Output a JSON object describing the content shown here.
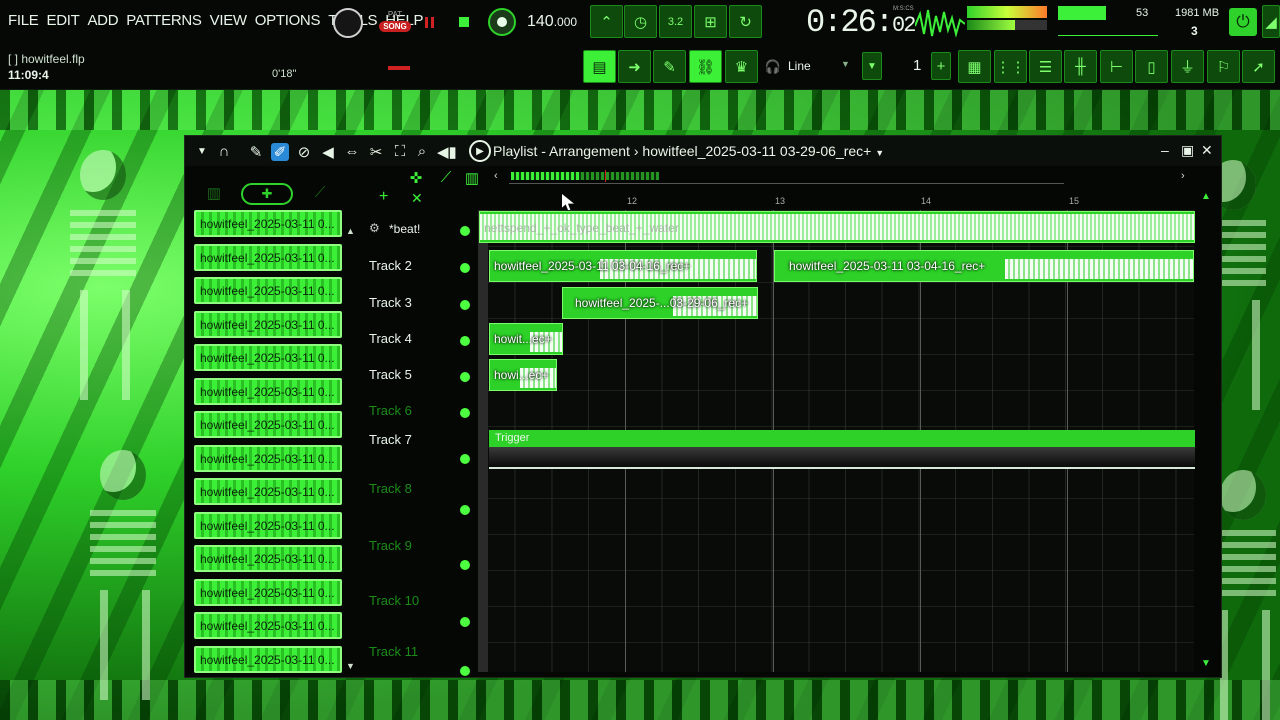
{
  "menu": [
    "FILE",
    "EDIT",
    "ADD",
    "PATTERNS",
    "VIEW",
    "OPTIONS",
    "TOOLS",
    "HELP"
  ],
  "project": {
    "file": "[   ] howitfeel.flp",
    "time": "11:09:4",
    "hint_time": "0'18\""
  },
  "transport": {
    "pat_label": "PAT",
    "song_label": "SONG",
    "tempo": "140",
    "tempo_frac": ".000",
    "clock": "0:26:",
    "clock_frac": "02",
    "clock_units": "M:S:CS",
    "cpu": "53",
    "memory": "1981 MB",
    "polyphony": "3"
  },
  "toolbar": {
    "line_mode": "Line",
    "snap": "1",
    "icons": [
      "metronome-icon",
      "wait-icon",
      "countdown-icon",
      "typing-keyboard-icon",
      "loop-record-icon"
    ]
  },
  "playlist": {
    "title": "Playlist - Arrangement",
    "separator": "›",
    "pattern_name": "howitfeel_2025-03-11 03-29-06_rec+",
    "ruler": [
      "12",
      "13",
      "14",
      "15"
    ],
    "patterns": [
      "howitfeel_2025-03-11 0...",
      "howitfeel_2025-03-11 0...",
      "howitfeel_2025-03-11 0...",
      "howitfeel_2025-03-11 0...",
      "howitfeel_2025-03-11 0...",
      "howitfeel_2025-03-11 0...",
      "howitfeel_2025-03-11 0...",
      "howitfeel_2025-03-11 0...",
      "howitfeel_2025-03-11 0...",
      "howitfeel_2025-03-11 0...",
      "howitfeel_2025-03-11 0...",
      "howitfeel_2025-03-11 0...",
      "howitfeel_2025-03-11 0...",
      "howitfeel_2025-03-11 0..."
    ],
    "tracks": [
      {
        "name": "*beat!",
        "dim": false
      },
      {
        "name": "Track 2",
        "dim": false
      },
      {
        "name": "Track 3",
        "dim": false
      },
      {
        "name": "Track 4",
        "dim": false
      },
      {
        "name": "Track 5",
        "dim": false
      },
      {
        "name": "Track 6",
        "dim": true
      },
      {
        "name": "Track 7",
        "dim": false
      },
      {
        "name": "Track 8",
        "dim": true
      },
      {
        "name": "Track 9",
        "dim": true
      },
      {
        "name": "Track 10",
        "dim": true
      },
      {
        "name": "Track 11",
        "dim": true
      }
    ],
    "clips": {
      "beat": "nettspend_+_ok_type_beat_+_water",
      "t2a": "howitfeel_2025-03-11 03-04-16_rec+",
      "t2b": "howitfeel_2025-03-11 03-04-16_rec+",
      "t3": "howitfeel_2025-...03-29-06_rec+",
      "t4": "howit...ec+",
      "t5": "howi...ec+",
      "trigger": "Trigger"
    }
  },
  "colors": {
    "accent": "#3bf036",
    "window_bg": "#050705",
    "record_red": "#d02222"
  }
}
